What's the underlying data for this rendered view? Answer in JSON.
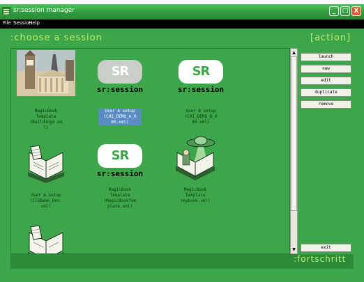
{
  "window": {
    "title": "sr:session manager",
    "controls": [
      "_",
      "□",
      "X"
    ]
  },
  "menu": [
    "File",
    "Session",
    "Help"
  ],
  "headings": {
    "choose": ":choose a session",
    "action": "[action]",
    "footer": ":fortschritt"
  },
  "sessions": [
    {
      "caption": "MagicBook\nTemplate\n(Buildings.xm\nl)",
      "icon": "photo-collage-icon"
    },
    {
      "caption": "User A setup\n(CHI_DEMO_A_0\n80.xml)",
      "icon": "sr-session-logo-gray",
      "selected": true
    },
    {
      "caption": "User B setup\n(CHI_DEMO_B_0\n80.xml)",
      "icon": "sr-session-logo"
    },
    {
      "caption": "User A setup\n(ITSDemo_Dev.\nxml)",
      "icon": "open-book-icon"
    },
    {
      "caption": "MagicBook\nTemplate\n(MagicBookTem\nplate.xml)",
      "icon": "sr-session-logo"
    },
    {
      "caption": "MagicBook\nTemplate\n(mybook.xml)",
      "icon": "book-ufo-icon"
    },
    {
      "caption": "",
      "icon": "open-book-icon"
    }
  ],
  "logo_text": "sr:session",
  "logo_mark": "SR",
  "actions": {
    "launch": "launch",
    "new": "new",
    "edit": "edit",
    "duplicate": "duplicate",
    "remove": "remove",
    "exit": "exit"
  },
  "colors": {
    "window_bg": "#3da64a",
    "heading": "#b7ec73",
    "selection": "#5a8cc4",
    "menubar": "#000000"
  }
}
